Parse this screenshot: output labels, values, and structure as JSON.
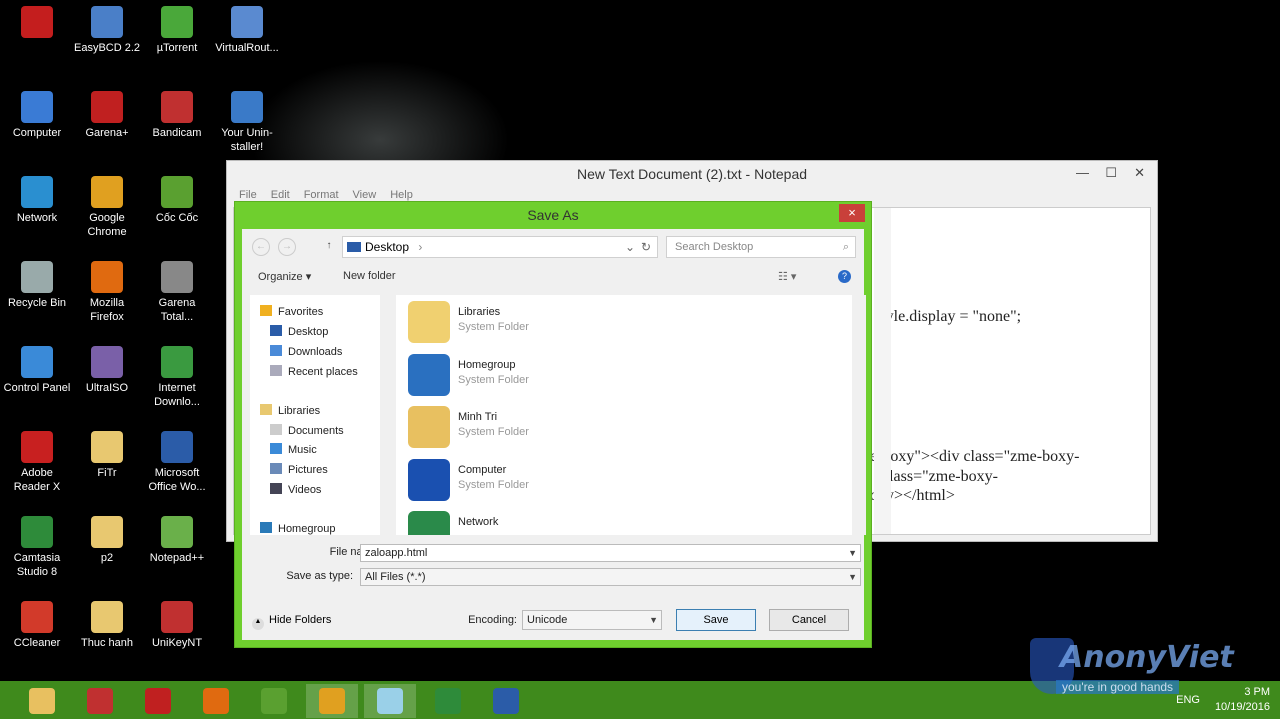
{
  "desktop": {
    "icons": [
      {
        "label": "",
        "color": "#c41e1e"
      },
      {
        "label": "Computer",
        "color": "#3a7bd5"
      },
      {
        "label": "Network",
        "color": "#2a8fd0"
      },
      {
        "label": "Recycle Bin",
        "color": "#9aa"
      },
      {
        "label": "Control Panel",
        "color": "#3a8ad8"
      },
      {
        "label": "Adobe Reader X",
        "color": "#c82020"
      },
      {
        "label": "Camtasia Studio 8",
        "color": "#2e8b3a"
      },
      {
        "label": "CCleaner",
        "color": "#d23a2a"
      },
      {
        "label": "EasyBCD 2.2",
        "color": "#4a7fc8"
      },
      {
        "label": "Garena+",
        "color": "#c02020"
      },
      {
        "label": "Google Chrome",
        "color": "#e0a020"
      },
      {
        "label": "Mozilla Firefox",
        "color": "#e06a10"
      },
      {
        "label": "UltraISO",
        "color": "#7a60a8"
      },
      {
        "label": "FiTr",
        "color": "#e8c870"
      },
      {
        "label": "p2",
        "color": "#e8c870"
      },
      {
        "label": "Thuc hanh",
        "color": "#e8c870"
      },
      {
        "label": "µTorrent",
        "color": "#4aa83a"
      },
      {
        "label": "Bandicam",
        "color": "#c03030"
      },
      {
        "label": "Cốc Cốc",
        "color": "#5aa030"
      },
      {
        "label": "Garena Total...",
        "color": "#888"
      },
      {
        "label": "Internet Downlo...",
        "color": "#3a9a40"
      },
      {
        "label": "Microsoft Office Wo...",
        "color": "#2b5ca8"
      },
      {
        "label": "Notepad++",
        "color": "#6ab04a"
      },
      {
        "label": "UniKeyNT",
        "color": "#c03030"
      },
      {
        "label": "VirtualRout...",
        "color": "#5a8ad0"
      },
      {
        "label": "Your Unin-staller!",
        "color": "#3a7ac8"
      }
    ]
  },
  "notepad": {
    "title": "New Text Document (2).txt - Notepad",
    "menu": [
      "File",
      "Edit",
      "Format",
      "View",
      "Help"
    ],
    "lines": [
      "style.display = \"none\";",
      "e-boxy\"><div class=\"zme-boxy-",
      "class=\"zme-boxy-",
      "ody></html>"
    ]
  },
  "dialog": {
    "title": "Save As",
    "close": "×",
    "address": "Desktop",
    "address_arrow": "›",
    "search_placeholder": "Search Desktop",
    "organize": "Organize ▾",
    "new_folder": "New folder",
    "tree": [
      {
        "label": "Favorites",
        "color": "#f0b020"
      },
      {
        "label": "Desktop",
        "color": "#2a5ca8"
      },
      {
        "label": "Downloads",
        "color": "#4a8ad8"
      },
      {
        "label": "Recent places",
        "color": "#aab"
      },
      {
        "label": "Libraries",
        "color": "#e8c870"
      },
      {
        "label": "Documents",
        "color": "#ccc"
      },
      {
        "label": "Music",
        "color": "#3a8ad8"
      },
      {
        "label": "Pictures",
        "color": "#6a8ab8"
      },
      {
        "label": "Videos",
        "color": "#445"
      },
      {
        "label": "Homegroup",
        "color": "#2a7ab8"
      }
    ],
    "items": [
      {
        "name": "Libraries",
        "type": "System Folder",
        "color": "#f0d070"
      },
      {
        "name": "Homegroup",
        "type": "System Folder",
        "color": "#2a70c0"
      },
      {
        "name": "Minh Tri",
        "type": "System Folder",
        "color": "#e8c060"
      },
      {
        "name": "Computer",
        "type": "System Folder",
        "color": "#1a50b0"
      },
      {
        "name": "Network",
        "type": "",
        "color": "#2a8a4a"
      }
    ],
    "file_name_label": "File name:",
    "file_name": "zaloapp.html",
    "save_type_label": "Save as type:",
    "save_type": "All Files  (*.*)",
    "hide_folders": "Hide Folders",
    "encoding_label": "Encoding:",
    "encoding": "Unicode",
    "save": "Save",
    "cancel": "Cancel"
  },
  "taskbar": {
    "apps": [
      {
        "name": "file-explorer",
        "color": "#e8c060"
      },
      {
        "name": "app",
        "color": "#c03030"
      },
      {
        "name": "garena",
        "color": "#c02020"
      },
      {
        "name": "firefox",
        "color": "#e06a10"
      },
      {
        "name": "coccoc",
        "color": "#5aa030"
      },
      {
        "name": "chrome",
        "color": "#e0a020"
      },
      {
        "name": "notepad",
        "color": "#9ad0e8"
      },
      {
        "name": "camtasia",
        "color": "#2e8b3a"
      },
      {
        "name": "word",
        "color": "#2b5ca8"
      }
    ],
    "lang": "ENG",
    "time": "3 PM",
    "date": "10/19/2016"
  },
  "watermark": {
    "brand": "AnonyViet",
    "tagline": "you're in good hands"
  }
}
